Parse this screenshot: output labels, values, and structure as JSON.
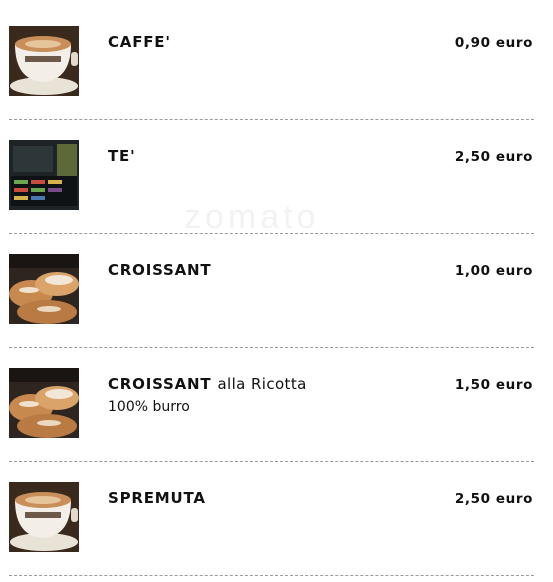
{
  "watermark": "zomato",
  "items": [
    {
      "name": "CAFFE'",
      "desc": "",
      "price": "0,90 euro",
      "image": "coffee-cup-icon"
    },
    {
      "name": "TE'",
      "desc": "",
      "price": "2,50 euro",
      "image": "tea-box-icon"
    },
    {
      "name": "CROISSANT",
      "desc": "",
      "price": "1,00 euro",
      "image": "croissant-icon"
    },
    {
      "name": "CROISSANT",
      "name_sub": "alla Ricotta",
      "desc": "100% burro",
      "price": "1,50 euro",
      "image": "croissant-icon"
    },
    {
      "name": "SPREMUTA",
      "desc": "",
      "price": "2,50 euro",
      "image": "coffee-cup-icon"
    }
  ]
}
